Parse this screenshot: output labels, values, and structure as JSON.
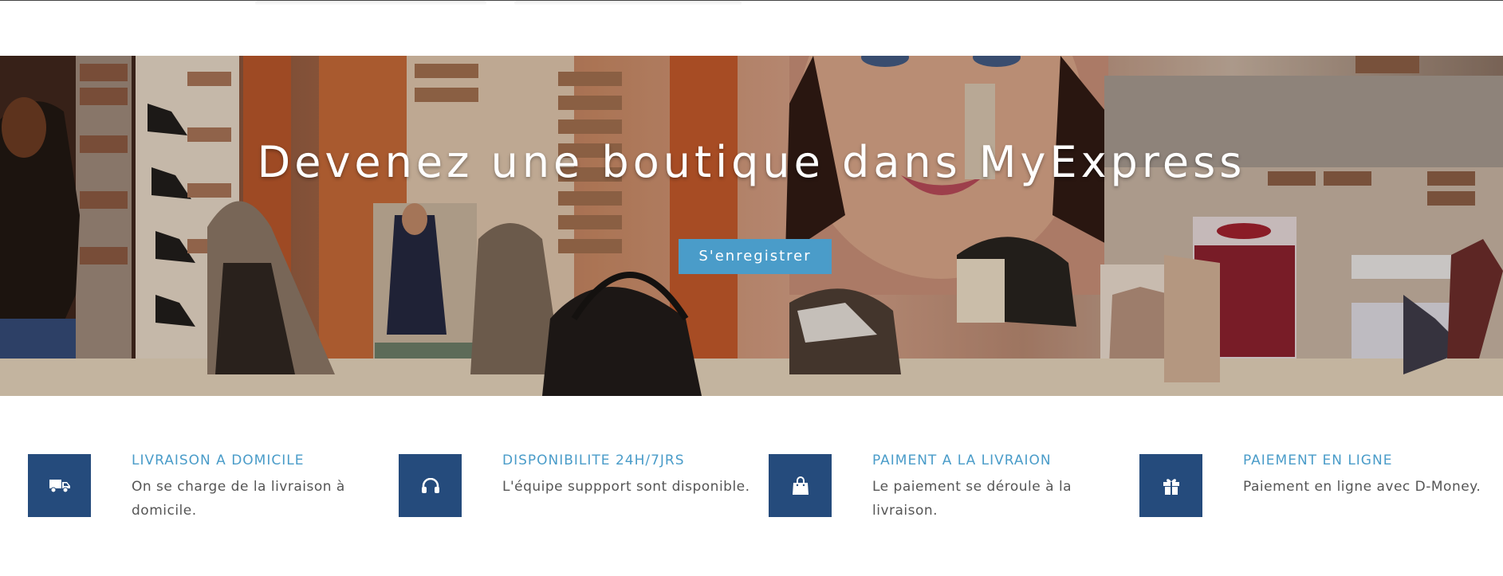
{
  "hero": {
    "title": "Devenez une boutique dans MyExpress",
    "button_label": "S'enregistrer"
  },
  "features": [
    {
      "icon": "truck-icon",
      "title": "LIVRAISON A DOMICILE",
      "description": "On se charge de la livraison à domicile."
    },
    {
      "icon": "headphones-icon",
      "title": "DISPONIBILITE 24H/7JRS",
      "description": "L'équipe suppport sont disponible."
    },
    {
      "icon": "shopping-bag-icon",
      "title": "PAIMENT A LA LIVRAION",
      "description": "Le paiement se déroule à la livraison."
    },
    {
      "icon": "gift-icon",
      "title": "PAIEMENT EN LIGNE",
      "description": "Paiement en ligne avec D-Money."
    }
  ],
  "colors": {
    "accent": "#4a9cc9",
    "icon_box": "#254b7c",
    "text": "#555555"
  }
}
